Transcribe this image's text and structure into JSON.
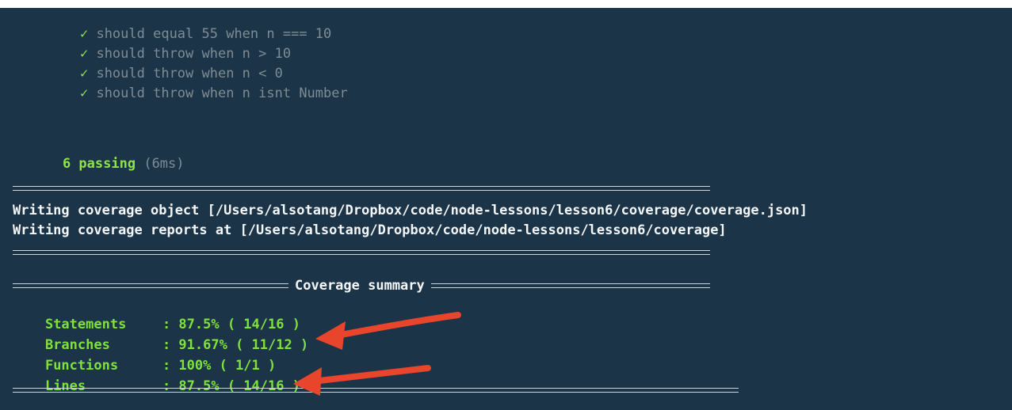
{
  "tests": [
    {
      "icon": "✓",
      "text": "should equal 55 when n === 10"
    },
    {
      "icon": "✓",
      "text": "should throw when n > 10"
    },
    {
      "icon": "✓",
      "text": "should throw when n < 0"
    },
    {
      "icon": "✓",
      "text": "should throw when n isnt Number"
    }
  ],
  "summary": {
    "passing": "6 passing",
    "time": "(6ms)"
  },
  "writing": [
    "Writing coverage object [/Users/alsotang/Dropbox/code/node-lessons/lesson6/coverage/coverage.json]",
    "Writing coverage reports at [/Users/alsotang/Dropbox/code/node-lessons/lesson6/coverage]"
  ],
  "coverage": {
    "title": "Coverage summary",
    "rows": [
      {
        "label": "Statements",
        "value": ": 87.5% ( 14/16 )"
      },
      {
        "label": "Branches",
        "value": ": 91.67% ( 11/12 )"
      },
      {
        "label": "Functions",
        "value": ": 100% ( 1/1 )"
      },
      {
        "label": "Lines",
        "value": ": 87.5% ( 14/16 )"
      }
    ]
  },
  "colors": {
    "background": "#1b3448",
    "pass": "#8ee34a",
    "arrow": "#e8452c"
  }
}
